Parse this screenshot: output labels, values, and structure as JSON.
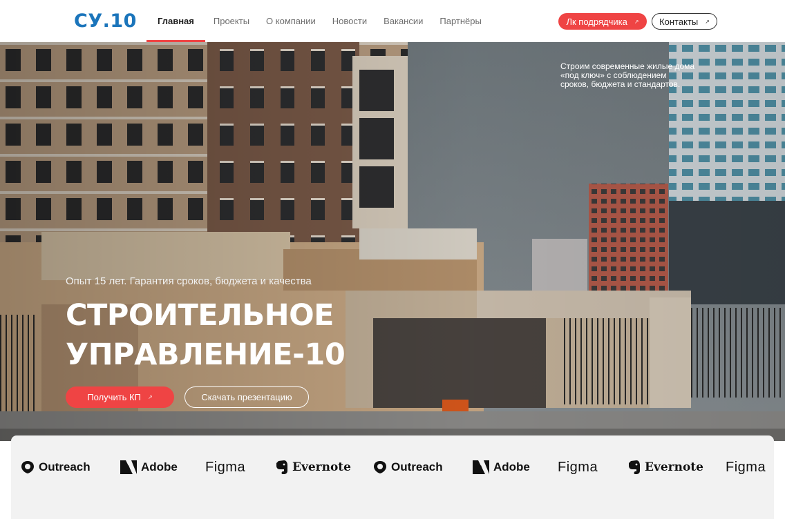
{
  "brand": {
    "logo_text": "СУ.10",
    "logo_color": "#1b75bb",
    "accent_color": "#ef4444"
  },
  "nav": {
    "items": [
      {
        "label": "Главная",
        "active": true
      },
      {
        "label": "Проекты",
        "active": false
      },
      {
        "label": "О компании",
        "active": false
      },
      {
        "label": "Новости",
        "active": false
      },
      {
        "label": "Вакансии",
        "active": false
      },
      {
        "label": "Партнёры",
        "active": false
      }
    ],
    "lk_button": "Лк подрядчика",
    "contacts_button": "Контакты",
    "arrow_icon": "arrow-up-right-icon"
  },
  "hero": {
    "aside_lines": [
      "Строим современные жилые дома",
      "«под ключ» с соблюдением",
      "сроков, бюджета и стандартов."
    ],
    "subtitle": "Опыт 15 лет. Гарантия сроков, бюджета и качества",
    "title_lines": [
      "СТРОИТЕЛЬНОЕ",
      "УПРАВЛЕНИЕ-10"
    ],
    "cta_primary": "Получить КП",
    "cta_secondary": "Скачать презентацию"
  },
  "partners": {
    "logos": [
      {
        "name": "Outreach",
        "icon": "outreach-icon"
      },
      {
        "name": "Adobe",
        "icon": "adobe-icon"
      },
      {
        "name": "Figma",
        "icon": ""
      },
      {
        "name": "Evernote",
        "icon": "evernote-icon"
      },
      {
        "name": "Outreach",
        "icon": "outreach-icon"
      },
      {
        "name": "Adobe",
        "icon": "adobe-icon"
      },
      {
        "name": "Figma",
        "icon": ""
      },
      {
        "name": "Evernote",
        "icon": "evernote-icon"
      },
      {
        "name": "Figma",
        "icon": ""
      }
    ]
  }
}
